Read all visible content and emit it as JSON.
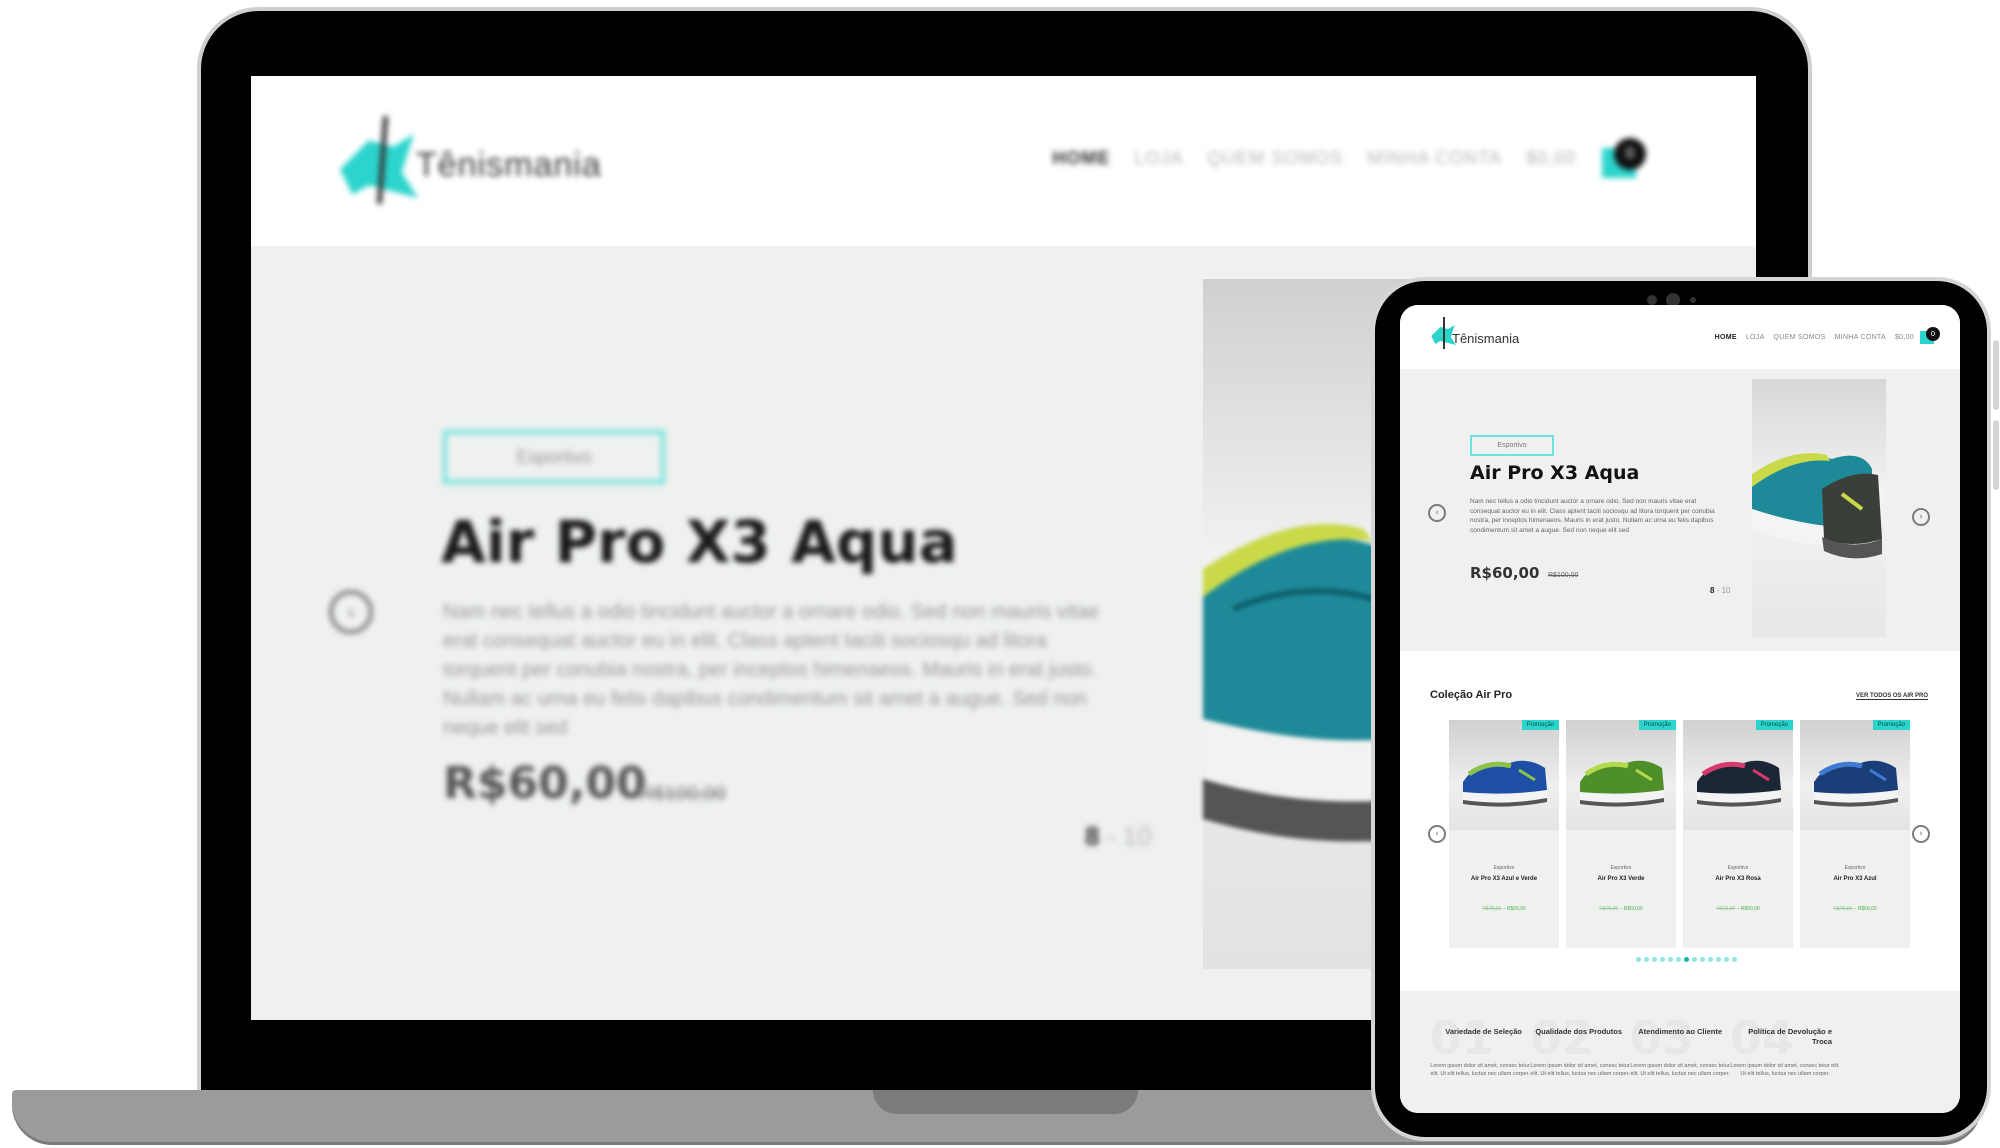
{
  "brand": {
    "name": "Tênismania",
    "accent": "#2bd4cc"
  },
  "nav": {
    "items": [
      "HOME",
      "LOJA",
      "QUEM SOMOS",
      "MINHA CONTA",
      "$0,00"
    ],
    "cart_count": "0"
  },
  "hero": {
    "badge": "Esportivo",
    "title": "Air Pro X3 Aqua",
    "description": "Nam nec tellus a odio tincidunt auctor a ornare odio. Sed non mauris vitae erat consequat auctor eu in elit. Class aptent taciti sociosqu ad litora torquent per conubia nostra, per inceptos himenaeos. Mauris in erat justo. Nullam ac urna eu felis dapibus condimentum sit amet a augue. Sed non neque elit sed",
    "price": "R$60,00",
    "old_price": "R$100,00",
    "slide_current": "8",
    "slide_total": "10",
    "prev_icon": "chevron-left-icon",
    "next_icon": "chevron-right-icon"
  },
  "collection": {
    "title": "Coleção Air Pro",
    "see_all": "VER TODOS OS AIR PRO",
    "products": [
      {
        "badge": "Promoção",
        "category": "Esportivo",
        "name": "Air Pro X3 Azul e Verde",
        "old_price": "R$75,00",
        "price": "R$60,00",
        "colors": [
          "#1d4fa7",
          "#8bc34a"
        ]
      },
      {
        "badge": "Promoção",
        "category": "Esportivo",
        "name": "Air Pro X3 Verde",
        "old_price": "R$75,00",
        "price": "R$60,00",
        "colors": [
          "#4e8f2a",
          "#b3d94d"
        ]
      },
      {
        "badge": "Promoção",
        "category": "Esportivo",
        "name": "Air Pro X3 Rosa",
        "old_price": "R$75,00",
        "price": "R$60,00",
        "colors": [
          "#1b2636",
          "#d63a6b"
        ]
      },
      {
        "badge": "Promoção",
        "category": "Esportivo",
        "name": "Air Pro X3 Azul",
        "old_price": "R$75,00",
        "price": "R$60,00",
        "colors": [
          "#1a3f78",
          "#3e7bd1"
        ]
      }
    ],
    "dot_count": 13,
    "active_dot": 6
  },
  "features": [
    {
      "num": "01",
      "title": "Variedade de Seleção",
      "desc": "Lorem ipsum dolor sit amet, consec tetur elit. Ut elit tellus, luctus nec ullam corper."
    },
    {
      "num": "02",
      "title": "Qualidade dos Produtos",
      "desc": "Lorem ipsum dolor sit amet, consec tetur elit. Ut elit tellus, luctus nec ullam corper."
    },
    {
      "num": "03",
      "title": "Atendimento ao Cliente",
      "desc": "Lorem ipsum dolor sit amet, consec tetur elit. Ut elit tellus, luctus nec ullam corper."
    },
    {
      "num": "04",
      "title": "Política de Devolução e Troca",
      "desc": "Lorem ipsum dolor sit amet, consec tetur elit. Ut elit tellus, luctus nec ullam corper."
    }
  ]
}
